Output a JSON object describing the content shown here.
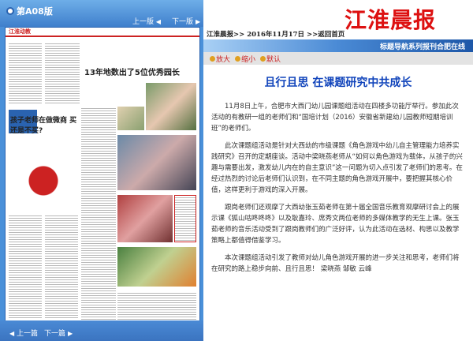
{
  "left_panel": {
    "edition": "第A08版",
    "prev_edition": "上一版",
    "next_edition": "下一版",
    "prev_page": "上一篇",
    "next_page": "下一篇",
    "paper": {
      "section": "江淮动教",
      "headline_1": "孩子老师在做微商 买还是不买?",
      "headline_2": "13年地数出了5位优秀园长"
    }
  },
  "header": {
    "logo": "江淮晨报",
    "breadcrumb": "江淮晨报>> 2016年11月17日 >>返回首页",
    "banner": "标题导航系列报刊合肥在线"
  },
  "toolbar": {
    "enlarge": "放大",
    "shrink": "缩小",
    "default": "默认"
  },
  "article": {
    "title": "且行且思 在课题研究中共成长",
    "paragraphs": [
      "11月8日上午，合肥市大西门幼儿园课题组活动在四楼多功能厅举行。参加此次活动的有教研一组的老师们和“国培计划（2016）安徽省新建幼儿园教师短期培训班”的老师们。",
      "此次课题组活动是针对大西幼的市级课题《角色游戏中幼儿自主管理能力培养实践研究》召开的定期座谈。活动中梁晓燕老师从“如何以角色游戏为载体，从孩子的兴趣与需要出发，激发幼儿内在的自主意识”这一问题为切入点引发了老师们的思考。在经过热烈的讨论后老师们认识到，在不同主题的角色游戏开展中，要把握其核心价值，这样更利于游戏的深入开展。",
      "跟岗老师们还观摩了大西幼张玉茹老师在第十届全国音乐教育观摩研讨会上的展示课《狐山咕咚咚咚》以及耿嘉玲、席秀文两位老师的多媒体教学的无生上课。张玉茹老师的音乐活动受到了跟岗教师们的广泛好评，认为此活动在选材、构思以及教学策略上都值得借鉴学习。",
      "本次课题组活动引发了教师对幼儿角色游戏开展的进一步关注和思考，老师们将在研究的路上稳步向前、且行且思！ 梁晓燕 邹敏 云峰"
    ]
  },
  "colors": {
    "panel_blue": "#4a90d9",
    "logo_red": "#dd1111",
    "title_blue": "#1144bb"
  }
}
